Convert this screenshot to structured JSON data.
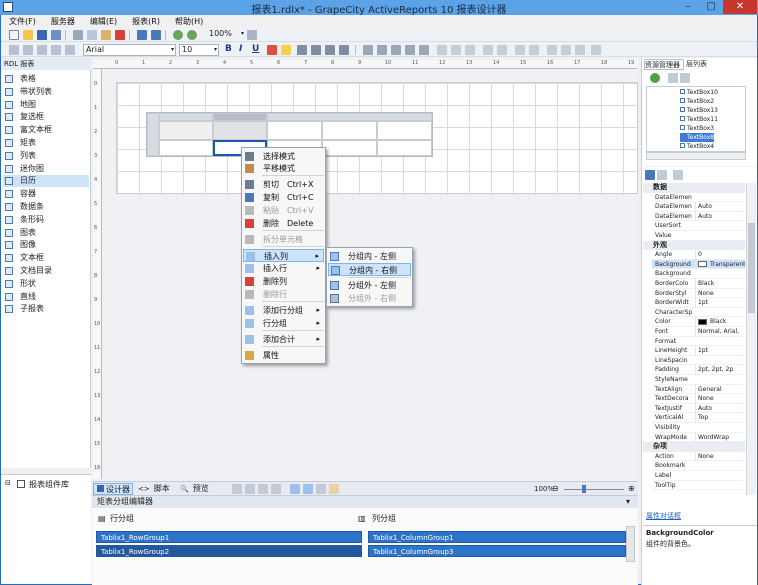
{
  "window": {
    "title": "报表1.rdlx* - GrapeCity ActiveReports 10 报表设计器"
  },
  "menu": [
    "文件(F)",
    "服务器",
    "编辑(E)",
    "报表(R)",
    "帮助(H)"
  ],
  "toolbar": {
    "zoom": "100%",
    "font": "Arial",
    "font_size": "10"
  },
  "toolbox": {
    "title": "RDL 报表",
    "items": [
      "表格",
      "带状列表",
      "地图",
      "复选框",
      "富文本框",
      "矩表",
      "列表",
      "迷你图",
      "日历",
      "容器",
      "数据条",
      "条形码",
      "图表",
      "图像",
      "文本框",
      "文档目录",
      "形状",
      "直线",
      "子报表"
    ],
    "library_title": "报表组件库"
  },
  "context_menu": {
    "items": [
      {
        "label": "选择模式",
        "shortcut": "",
        "disabled": false
      },
      {
        "label": "平移模式",
        "shortcut": "",
        "disabled": false
      },
      {
        "label": "剪切",
        "shortcut": "Ctrl+X",
        "disabled": false
      },
      {
        "label": "复制",
        "shortcut": "Ctrl+C",
        "disabled": false
      },
      {
        "label": "粘贴",
        "shortcut": "Ctrl+V",
        "disabled": true
      },
      {
        "label": "删除",
        "shortcut": "Delete",
        "disabled": false
      },
      {
        "label": "拆分单元格",
        "shortcut": "",
        "disabled": true
      },
      {
        "label": "插入列",
        "shortcut": "",
        "disabled": false
      },
      {
        "label": "插入行",
        "shortcut": "",
        "disabled": false
      },
      {
        "label": "删除列",
        "shortcut": "",
        "disabled": false
      },
      {
        "label": "删除行",
        "shortcut": "",
        "disabled": true
      },
      {
        "label": "添加行分组",
        "shortcut": "",
        "disabled": false
      },
      {
        "label": "行分组",
        "shortcut": "",
        "disabled": false
      },
      {
        "label": "添加合计",
        "shortcut": "",
        "disabled": false
      },
      {
        "label": "属性",
        "shortcut": "",
        "disabled": false
      }
    ],
    "submenu": [
      {
        "label": "分组内 - 左侧",
        "disabled": false
      },
      {
        "label": "分组内 - 右侧",
        "disabled": false
      },
      {
        "label": "分组外 - 左侧",
        "disabled": false
      },
      {
        "label": "分组外 - 右侧",
        "disabled": true
      }
    ]
  },
  "designer_tabs": {
    "designer": "设计器",
    "script": "脚本",
    "preview": "预览",
    "zoom": "100%"
  },
  "group_editor": {
    "title": "矩表分组编辑器",
    "row_header": "行分组",
    "col_header": "列分组",
    "row_groups": [
      "Tablix1_RowGroup1",
      "Tablix1_RowGroup2"
    ],
    "col_groups": [
      "Tablix1_ColumnGroup1",
      "Tablix1_ColumnGroup3"
    ]
  },
  "explorer": {
    "tab_resources": "资源管理器",
    "tab_layers": "层列表",
    "items": [
      "TextBox10",
      "TextBox2",
      "TextBox13",
      "TextBox11",
      "TextBox3",
      "TextBox8",
      "TextBox4"
    ]
  },
  "properties": {
    "rows": [
      {
        "cat": true,
        "name": "数据"
      },
      {
        "name": "DataElemen",
        "value": ""
      },
      {
        "name": "DataElemen",
        "value": "Auto"
      },
      {
        "name": "DataElemen",
        "value": "Auto"
      },
      {
        "name": "UserSort",
        "value": ""
      },
      {
        "name": "Value",
        "value": ""
      },
      {
        "cat": true,
        "name": "外观"
      },
      {
        "name": "Angle",
        "value": "0"
      },
      {
        "name": "Background",
        "value": "Transparent"
      },
      {
        "name": "Background",
        "value": ""
      },
      {
        "name": "BorderColo",
        "value": "Black"
      },
      {
        "name": "BorderStyl",
        "value": "None"
      },
      {
        "name": "BorderWidt",
        "value": "1pt"
      },
      {
        "name": "CharacterSp",
        "value": ""
      },
      {
        "name": "Color",
        "value": "Black"
      },
      {
        "name": "Font",
        "value": "Normal, Arial,"
      },
      {
        "name": "Format",
        "value": ""
      },
      {
        "name": "LineHeight",
        "value": "1pt"
      },
      {
        "name": "LineSpacin",
        "value": ""
      },
      {
        "name": "Padding",
        "value": "2pt, 2pt, 2p"
      },
      {
        "name": "StyleName",
        "value": ""
      },
      {
        "name": "TextAlign",
        "value": "General"
      },
      {
        "name": "TextDecora",
        "value": "None"
      },
      {
        "name": "TextJustif",
        "value": "Auto"
      },
      {
        "name": "VerticalAl",
        "value": "Top"
      },
      {
        "name": "Visibility",
        "value": ""
      },
      {
        "name": "WrapMode",
        "value": "WordWrap"
      },
      {
        "cat": true,
        "name": "杂项"
      },
      {
        "name": "Action",
        "value": "None"
      },
      {
        "name": "Bookmark",
        "value": ""
      },
      {
        "name": "Label",
        "value": ""
      },
      {
        "name": "ToolTip",
        "value": ""
      }
    ],
    "link": "属性对话框",
    "desc_title": "BackgroundColor",
    "desc_text": "组件的背景色。"
  }
}
